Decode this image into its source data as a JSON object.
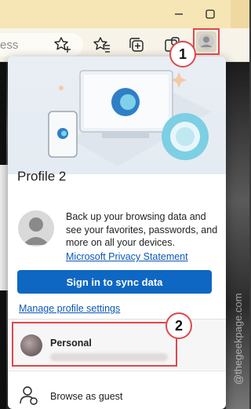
{
  "browser": {
    "address_text": "ess",
    "toolbar_icons": [
      "add-favorite-icon",
      "favorites-icon",
      "collections-icon",
      "extensions-icon",
      "profile-icon"
    ],
    "window_buttons": [
      "minimize-icon",
      "maximize-icon"
    ]
  },
  "profile_popup": {
    "title": "Profile 2",
    "description": "Back up your browsing data and see your favorites, passwords, and more on all your devices.",
    "privacy_link": "Microsoft Privacy Statement",
    "sign_in_button": "Sign in to sync data",
    "manage_link": "Manage profile settings",
    "other_profiles": [
      {
        "name": "Personal"
      }
    ],
    "guest_label": "Browse as guest"
  },
  "annotations": {
    "step1": "1",
    "step2": "2",
    "highlight_color": "#e0474c"
  },
  "watermark": "@thegeekpage.com",
  "colors": {
    "accent": "#0e67c2",
    "link": "#0b57b8",
    "titlebar": "#f6e6b6"
  }
}
